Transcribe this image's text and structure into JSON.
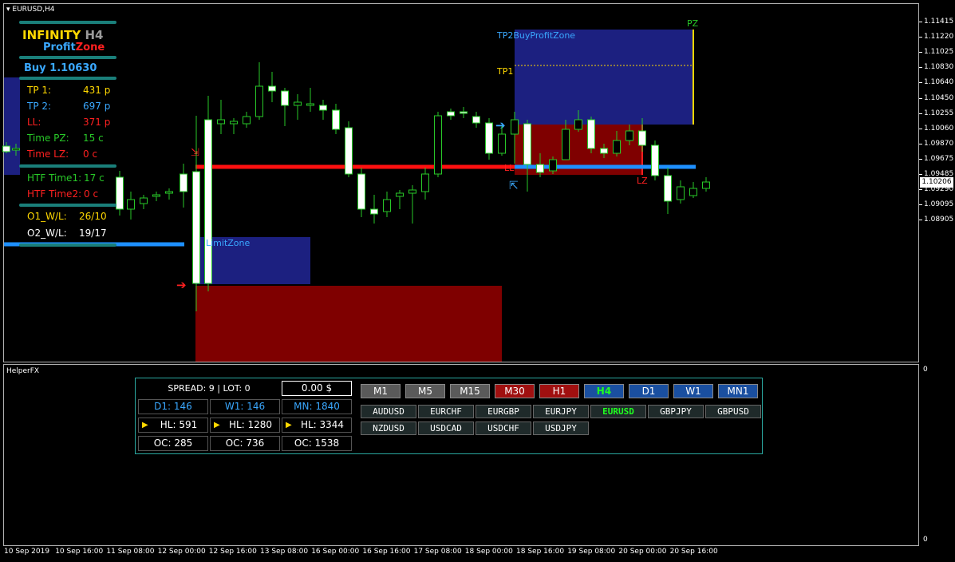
{
  "chart": {
    "title": "EURUSD,H4",
    "current_price": "1.10206",
    "price_labels": [
      "1.11415",
      "1.11220",
      "1.11025",
      "1.10830",
      "1.10640",
      "1.10450",
      "1.10255",
      "1.10060",
      "1.09870",
      "1.09675",
      "1.09485",
      "1.09290",
      "1.09095",
      "1.08905"
    ],
    "time_labels": [
      "10 Sep 2019",
      "10 Sep 16:00",
      "11 Sep 08:00",
      "12 Sep 00:00",
      "12 Sep 16:00",
      "13 Sep 08:00",
      "16 Sep 00:00",
      "16 Sep 16:00",
      "17 Sep 08:00",
      "18 Sep 00:00",
      "18 Sep 16:00",
      "19 Sep 08:00",
      "20 Sep 00:00",
      "20 Sep 16:00"
    ],
    "zone_labels": {
      "pz": "PZ",
      "tp2": "TP2BuyProfitZone",
      "tp1": "TP1",
      "ll": "LL",
      "lz": "LZ",
      "limit_zone": "LimitZone"
    }
  },
  "subwindow": {
    "title": "HelperFX",
    "scale_top": "0",
    "scale_bottom": "0"
  },
  "panel": {
    "brand_word1": "INFINITY",
    "brand_tf": "H4",
    "brand_word2": "Profit",
    "brand_word3": "Zone",
    "signal": "Buy 1.10630",
    "rows": [
      {
        "label": "TP 1:",
        "value": "431 p",
        "color": "#ffd800",
        "vcolor": "#ffd800"
      },
      {
        "label": "TP 2:",
        "value": "697 p",
        "color": "#3aa8ff",
        "vcolor": "#3aa8ff"
      },
      {
        "label": "LL:",
        "value": "371 p",
        "color": "#ff2020",
        "vcolor": "#ff2020"
      },
      {
        "label": "Time PZ:",
        "value": "15 c",
        "color": "#28c828",
        "vcolor": "#28c828"
      },
      {
        "label": "Time LZ:",
        "value": "0 c",
        "color": "#ff2020",
        "vcolor": "#ff2020"
      }
    ],
    "htf": [
      {
        "label": "HTF Time1:",
        "value": "17 c",
        "color": "#28c828"
      },
      {
        "label": "HTF Time2:",
        "value": "0 c",
        "color": "#ff2020"
      }
    ],
    "wl": [
      {
        "label": "O1_W/L:",
        "value": "26/10",
        "color": "#ffd800"
      },
      {
        "label": "O2_W/L:",
        "value": "19/17",
        "color": "#ffffff"
      }
    ]
  },
  "helper": {
    "spread_lot": "SPREAD: 9  |  LOT: 0",
    "balance": "0.00 $",
    "d1": "D1: 146",
    "w1": "W1: 146",
    "mn": "MN: 1840",
    "hl": [
      "HL: 591",
      "HL: 1280",
      "HL: 3344"
    ],
    "oc": [
      "OC: 285",
      "OC: 736",
      "OC: 1538"
    ],
    "timeframes": [
      {
        "label": "M1",
        "bg": "#5a5a5a",
        "fg": "#ffffff"
      },
      {
        "label": "M5",
        "bg": "#5a5a5a",
        "fg": "#ffffff"
      },
      {
        "label": "M15",
        "bg": "#5a5a5a",
        "fg": "#ffffff"
      },
      {
        "label": "M30",
        "bg": "#a01010",
        "fg": "#ffffff"
      },
      {
        "label": "H1",
        "bg": "#a01010",
        "fg": "#ffffff"
      },
      {
        "label": "H4",
        "bg": "#1a4fa0",
        "fg": "#20ff20"
      },
      {
        "label": "D1",
        "bg": "#1a4fa0",
        "fg": "#ffffff"
      },
      {
        "label": "W1",
        "bg": "#1a4fa0",
        "fg": "#ffffff"
      },
      {
        "label": "MN1",
        "bg": "#1a4fa0",
        "fg": "#ffffff"
      }
    ],
    "symbols_row1": [
      "AUDUSD",
      "EURCHF",
      "EURGBP",
      "EURJPY",
      "EURUSD",
      "GBPJPY",
      "GBPUSD"
    ],
    "symbols_row2": [
      "NZDUSD",
      "USDCAD",
      "USDCHF",
      "USDJPY"
    ],
    "active_symbol": "EURUSD"
  },
  "colors": {
    "bull": "#ffffff",
    "bear_outline": "#28c828",
    "blue_zone": "#1c2080",
    "red_zone": "#7f0000",
    "teal": "#1a7f7a"
  }
}
